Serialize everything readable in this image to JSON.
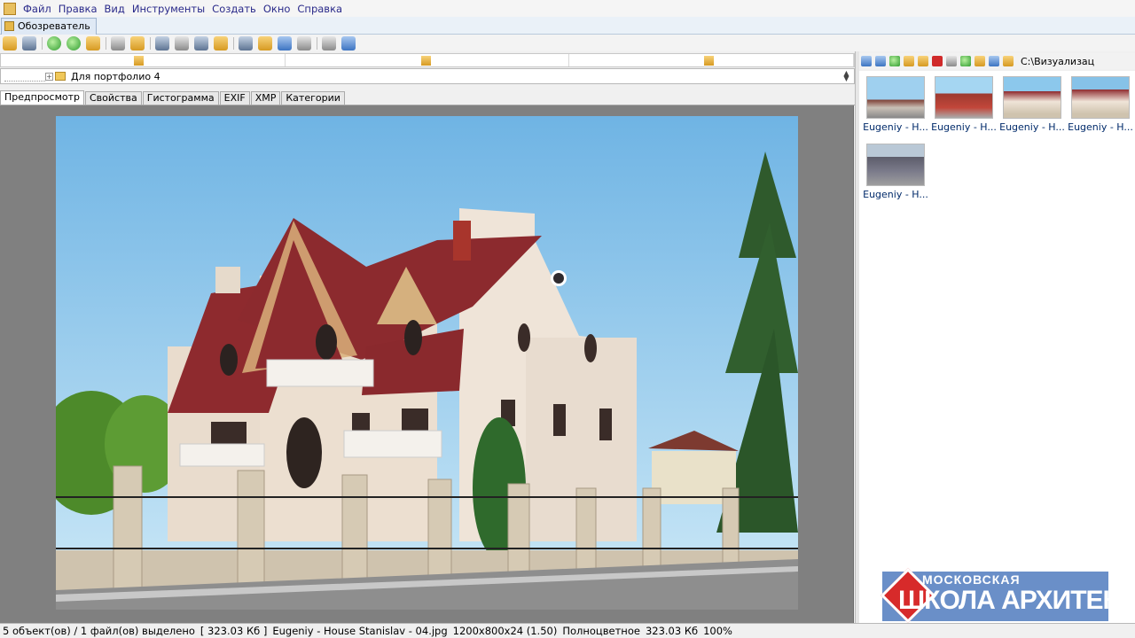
{
  "menu": [
    "Файл",
    "Правка",
    "Вид",
    "Инструменты",
    "Создать",
    "Окно",
    "Справка"
  ],
  "doc_tab": "Обозреватель",
  "path": "Для портфолио 4",
  "prop_tabs": [
    "Предпросмотр",
    "Свойства",
    "Гистограмма",
    "EXIF",
    "XMP",
    "Категории"
  ],
  "browser_path": "C:\\Визуализац",
  "thumbs": [
    "Eugeniy - H...",
    "Eugeniy - H...",
    "Eugeniy - H...",
    "Eugeniy - H...",
    "Eugeniy - H..."
  ],
  "logo": {
    "line1": "МОСКОВСКАЯ",
    "line2": "ШКОЛА АРХИТЕКТУРЫ"
  },
  "status": {
    "selection": "5 объект(ов) / 1 файл(ов) выделено",
    "size": "[ 323.03 Кб ]",
    "filename": "Eugeniy - House Stanislav - 04.jpg",
    "dims": "1200x800x24 (1.50)",
    "color": "Полноцветное",
    "filesize": "323.03 Кб",
    "zoom": "100%"
  },
  "colors": {
    "roof": "#8e2a2e",
    "wall": "#efe4d8",
    "sky": "#86c2e8",
    "logo": "#6a8fc8"
  }
}
